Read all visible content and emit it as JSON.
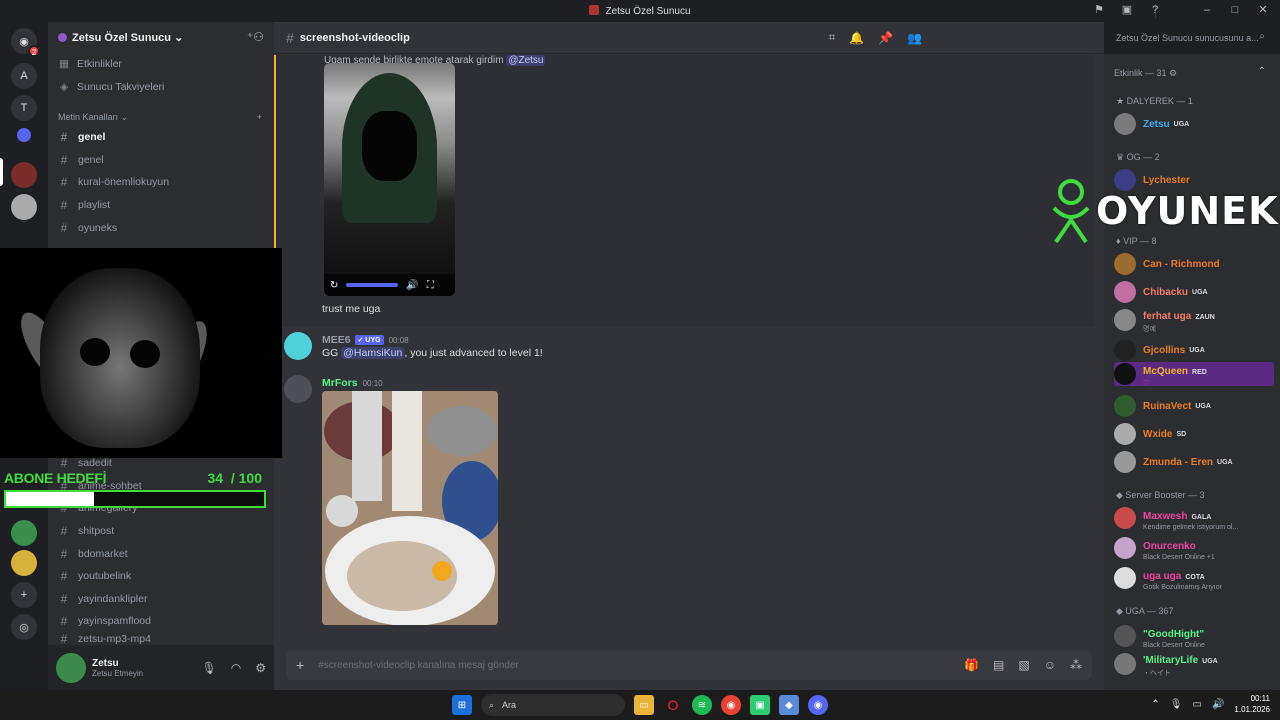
{
  "window": {
    "title": "Zetsu Özel Sunucu"
  },
  "rail": {
    "letters": [
      "A",
      "T"
    ],
    "badge": "2"
  },
  "sidebar": {
    "server_name": "Zetsu Özel Sunucu",
    "top_items": [
      "Etkinlikler",
      "Sunucu Takviyeleri"
    ],
    "category": "Metin Kanalları",
    "channels": [
      "genel",
      "genel",
      "kural-önemliokuyun",
      "playlist",
      "oyuneks"
    ],
    "channels_lower": [
      "sadedit",
      "anime-sohbet",
      "animegallery",
      "shitpost",
      "bdomarket",
      "youtubelink",
      "yayindanklipler",
      "yayinspamflood",
      "zetsu-mp3-mp4"
    ],
    "user_name": "Zetsu",
    "user_status": "Zetsu Etmeyin"
  },
  "overlay": {
    "goal_title": "ABONE HEDEFİ",
    "goal_current": "34",
    "goal_total": "/ 100",
    "goal_fraction": 0.34,
    "brand": "OYUNEKS"
  },
  "chat": {
    "channel": "screenshot-videoclip",
    "system_line": "Ugam sende birlikte emote atarak girdim",
    "system_mention": "@Zetsu",
    "msg1": "trust me uga",
    "msg2": {
      "user": "MEE6",
      "tag": "✓ UYG",
      "time": "00:08",
      "pre": "GG ",
      "mention": "@HamsiKun",
      "post": ", you just advanced to level 1!"
    },
    "msg3": {
      "user": "MrFors",
      "time": "00:10"
    },
    "composer_placeholder": "#screenshot-videoclip kanalına mesaj gönder"
  },
  "search": {
    "placeholder": "Zetsu Özel Sunucu sunucusunu a..."
  },
  "members": {
    "header": "Etkinlik — 31",
    "groups": [
      {
        "label": "DALYEREK — 1"
      },
      {
        "label": "OG — 2"
      },
      {
        "label": "VIP — 8"
      },
      {
        "label": "Server Booster — 3"
      },
      {
        "label": "UGA — 367"
      }
    ],
    "list": [
      {
        "name": "Zetsu",
        "badge": "UGA",
        "color": "#3ea8f0"
      },
      {
        "name": "Lychester",
        "badge": "",
        "color": "#e67e22"
      },
      {
        "name": "Can - Richmond",
        "badge": "",
        "color": "#e67e22"
      },
      {
        "name": "Chibacku",
        "badge": "UGA",
        "color": "#f47b67"
      },
      {
        "name": "ferhat uga",
        "badge": "ZAUN",
        "color": "#f47b67",
        "sub": "명예"
      },
      {
        "name": "Gjcollins",
        "badge": "UGA",
        "color": "#e67e22"
      },
      {
        "name": "McQueen",
        "badge": "RED",
        "color": "#f0b232",
        "sub": "♡"
      },
      {
        "name": "RuinaVect",
        "badge": "UGA",
        "color": "#e67e22"
      },
      {
        "name": "Wxide",
        "badge": "SD",
        "color": "#e67e22"
      },
      {
        "name": "Zmunda - Eren",
        "badge": "UGA",
        "color": "#e67e22"
      },
      {
        "name": "Maxwesh",
        "badge": "GALA",
        "color": "#eb459e",
        "sub": "Kendime gelmek istiyorum ol..."
      },
      {
        "name": "Onurcenko",
        "badge": "",
        "color": "#eb459e",
        "sub": "Black Desert Online +1"
      },
      {
        "name": "uga uga",
        "badge": "COTA",
        "color": "#eb459e",
        "sub": "Gotik Bozulmamış Arıyıor"
      },
      {
        "name": "\"GoodHight\"",
        "badge": "",
        "color": "#57f287",
        "sub": "Black Desert Online"
      },
      {
        "name": "'MilitaryLife",
        "badge": "UGA",
        "color": "#57f287",
        "sub": "・ヘイト"
      }
    ]
  },
  "taskbar": {
    "search": "Ara",
    "time": "00:11",
    "date": "1.01.2026"
  },
  "colors": {
    "accent": "#5865f2",
    "goal_green": "#3fdc3f",
    "highlight": "#f0b232"
  }
}
